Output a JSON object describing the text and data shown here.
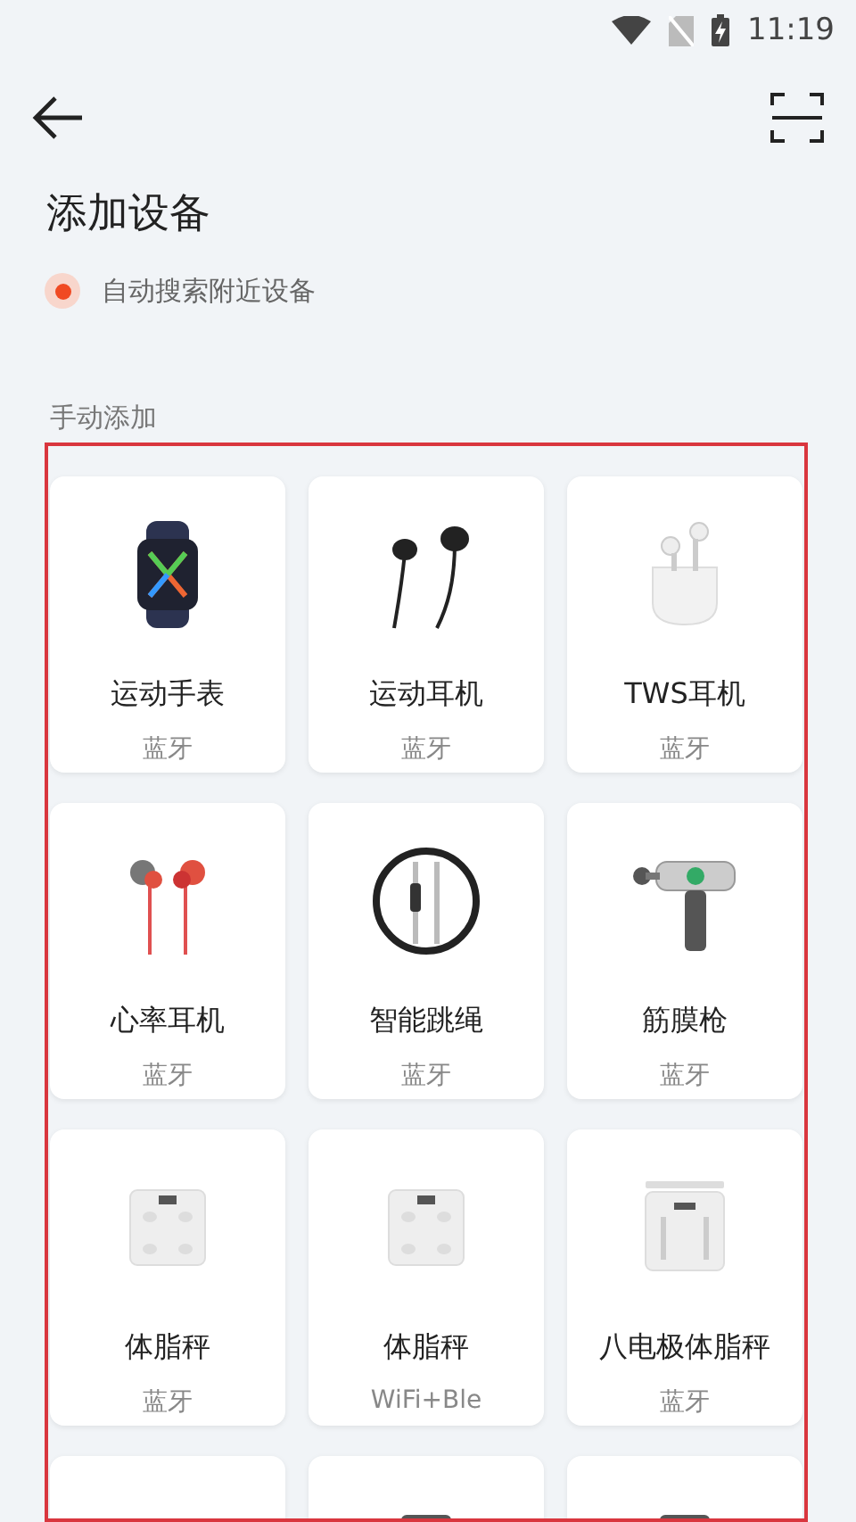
{
  "status_bar": {
    "time": "11:19"
  },
  "header": {
    "title": "添加设备"
  },
  "auto_search": {
    "label": "自动搜索附近设备",
    "on": true
  },
  "manual_section": {
    "label": "手动添加",
    "highlighted": true,
    "devices": [
      {
        "kind": "watch",
        "name": "运动手表",
        "connection": "蓝牙"
      },
      {
        "kind": "earphones",
        "name": "运动耳机",
        "connection": "蓝牙"
      },
      {
        "kind": "earbuds",
        "name": "TWS耳机",
        "connection": "蓝牙"
      },
      {
        "kind": "sporty",
        "name": "心率耳机",
        "connection": "蓝牙"
      },
      {
        "kind": "rope",
        "name": "智能跳绳",
        "connection": "蓝牙"
      },
      {
        "kind": "gun",
        "name": "筋膜枪",
        "connection": "蓝牙"
      },
      {
        "kind": "scale",
        "name": "体脂秤",
        "connection": "蓝牙"
      },
      {
        "kind": "scale",
        "name": "体脂秤",
        "connection": "WiFi+Ble"
      },
      {
        "kind": "electrode",
        "name": "八电极体脂秤",
        "connection": "蓝牙"
      },
      {
        "kind": "blank"
      },
      {
        "kind": "dark"
      },
      {
        "kind": "dark"
      }
    ]
  }
}
